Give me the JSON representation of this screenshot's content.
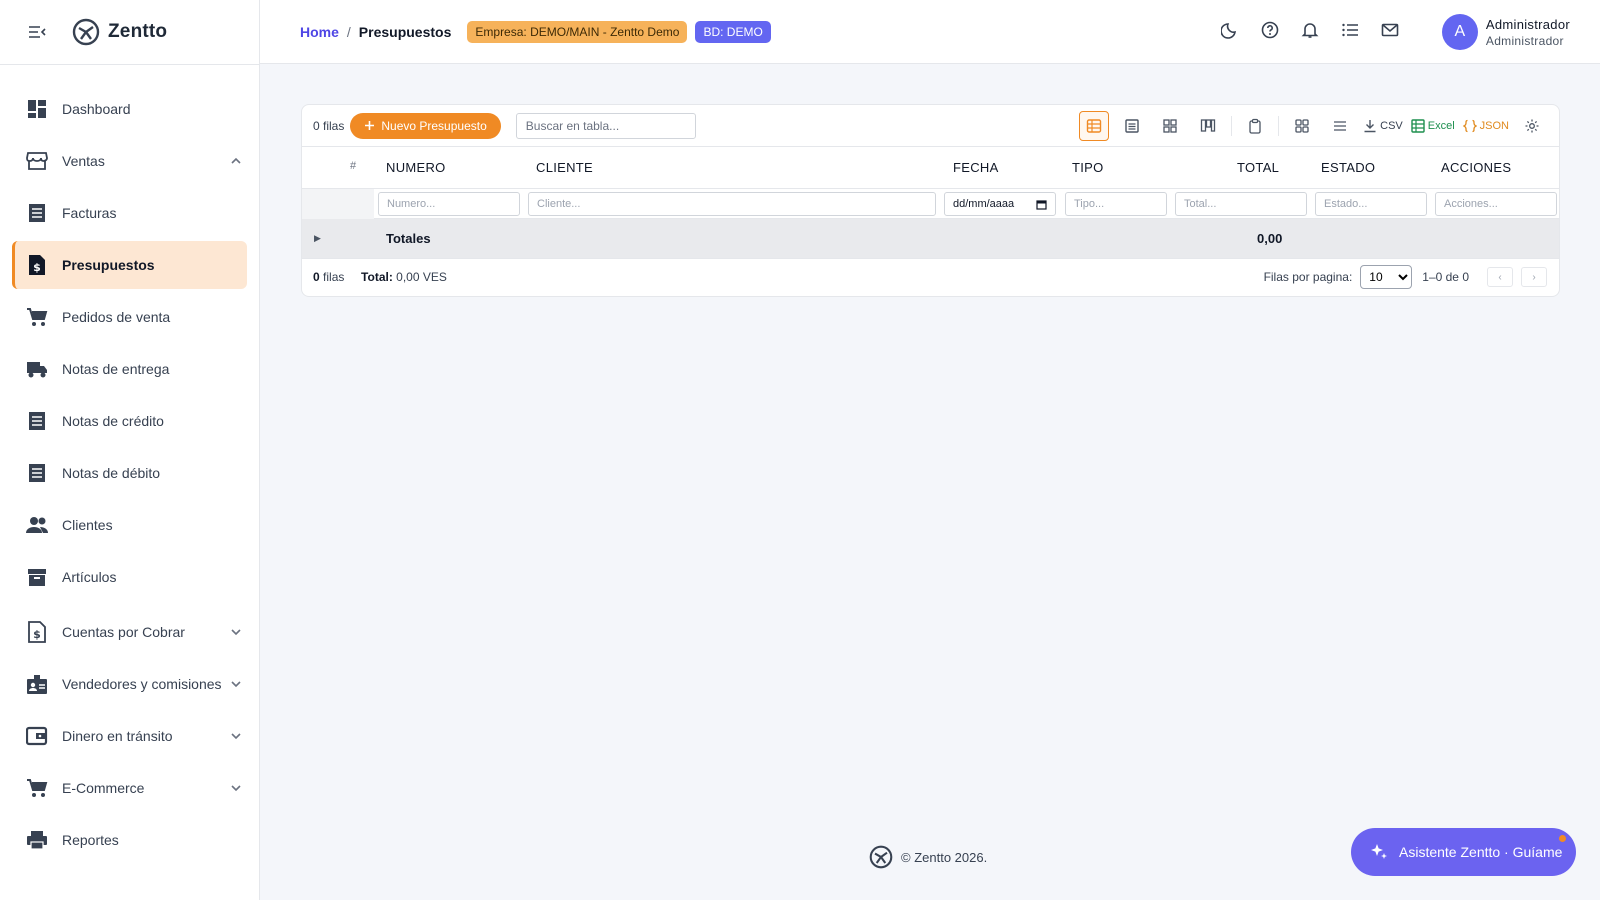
{
  "brand": {
    "name": "Zentto"
  },
  "sidebar": {
    "items": [
      {
        "label": "Dashboard"
      },
      {
        "label": "Ventas"
      },
      {
        "label": "Facturas"
      },
      {
        "label": "Presupuestos"
      },
      {
        "label": "Pedidos de venta"
      },
      {
        "label": "Notas de entrega"
      },
      {
        "label": "Notas de crédito"
      },
      {
        "label": "Notas de débito"
      },
      {
        "label": "Clientes"
      },
      {
        "label": "Artículos"
      },
      {
        "label": "Cuentas por Cobrar"
      },
      {
        "label": "Vendedores y comisiones"
      },
      {
        "label": "Dinero en tránsito"
      },
      {
        "label": "E-Commerce"
      },
      {
        "label": "Reportes"
      }
    ]
  },
  "header": {
    "breadcrumb": {
      "home": "Home",
      "separator": "/",
      "current": "Presupuestos"
    },
    "company_badge": "Empresa: DEMO/MAIN - Zentto Demo",
    "db_badge": "BD: DEMO",
    "user": {
      "initial": "A",
      "name": "Administrador",
      "role": "Administrador"
    }
  },
  "table": {
    "toolbar": {
      "rows_count": "0 filas",
      "new_button": "Nuevo Presupuesto",
      "search_placeholder": "Buscar en tabla...",
      "csv_label": "CSV",
      "excel_label": "Excel",
      "json_label": "JSON"
    },
    "columns": {
      "index": "#",
      "numero": "NUMERO",
      "cliente": "CLIENTE",
      "fecha": "FECHA",
      "tipo": "TIPO",
      "total": "TOTAL",
      "estado": "ESTADO",
      "acciones": "ACCIONES"
    },
    "filters": {
      "numero": "Numero...",
      "cliente": "Cliente...",
      "fecha": "dd/mm/aaaa",
      "tipo": "Tipo...",
      "total": "Total...",
      "estado": "Estado...",
      "acciones": "Acciones..."
    },
    "totals": {
      "expander": "▶",
      "label": "Totales",
      "value": "0,00"
    },
    "footer": {
      "rows_count": "0",
      "rows_word": "filas",
      "total_label": "Total:",
      "total_value": "0,00 VES",
      "per_page_label": "Filas por pagina:",
      "per_page_value": "10",
      "range": "1–0 de 0",
      "prev": "‹",
      "next": "›"
    }
  },
  "page_footer": {
    "copyright": "© Zentto 2026."
  },
  "assistant": {
    "label": "Asistente Zentto · Guíame"
  },
  "colors": {
    "accent": "#f08a24",
    "primary": "#6366f1",
    "active_bg": "#fde7d3"
  }
}
